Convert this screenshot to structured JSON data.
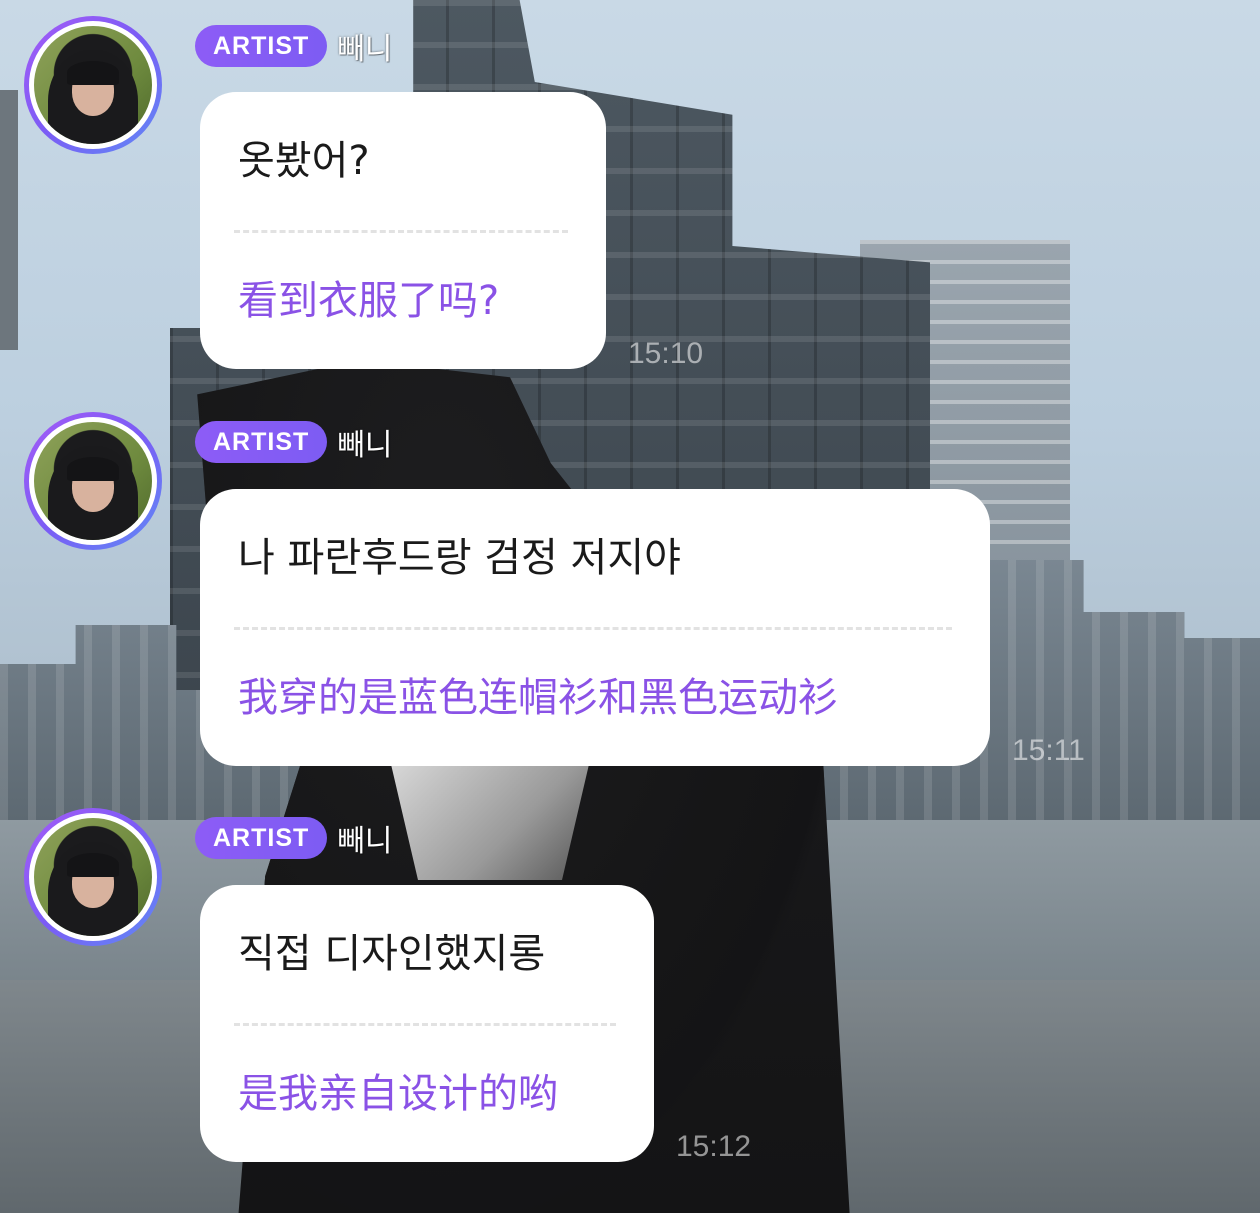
{
  "messages": [
    {
      "badge": "ARTIST",
      "name": "빼니",
      "original": "옷봤어?",
      "translated": "看到衣服了吗?",
      "time": "15:10"
    },
    {
      "badge": "ARTIST",
      "name": "빼니",
      "original": "나 파란후드랑 검정 저지야",
      "translated": "我穿的是蓝色连帽衫和黑色运动衫",
      "time": "15:11"
    },
    {
      "badge": "ARTIST",
      "name": "빼니",
      "original": "직접 디자인했지롱",
      "translated": "是我亲自设计的哟",
      "time": "15:12"
    }
  ],
  "colors": {
    "badge": "#8d5cf6",
    "translated_text": "#8a52e6",
    "bubble": "#ffffff",
    "avatar_ring": "#a55bf7"
  }
}
